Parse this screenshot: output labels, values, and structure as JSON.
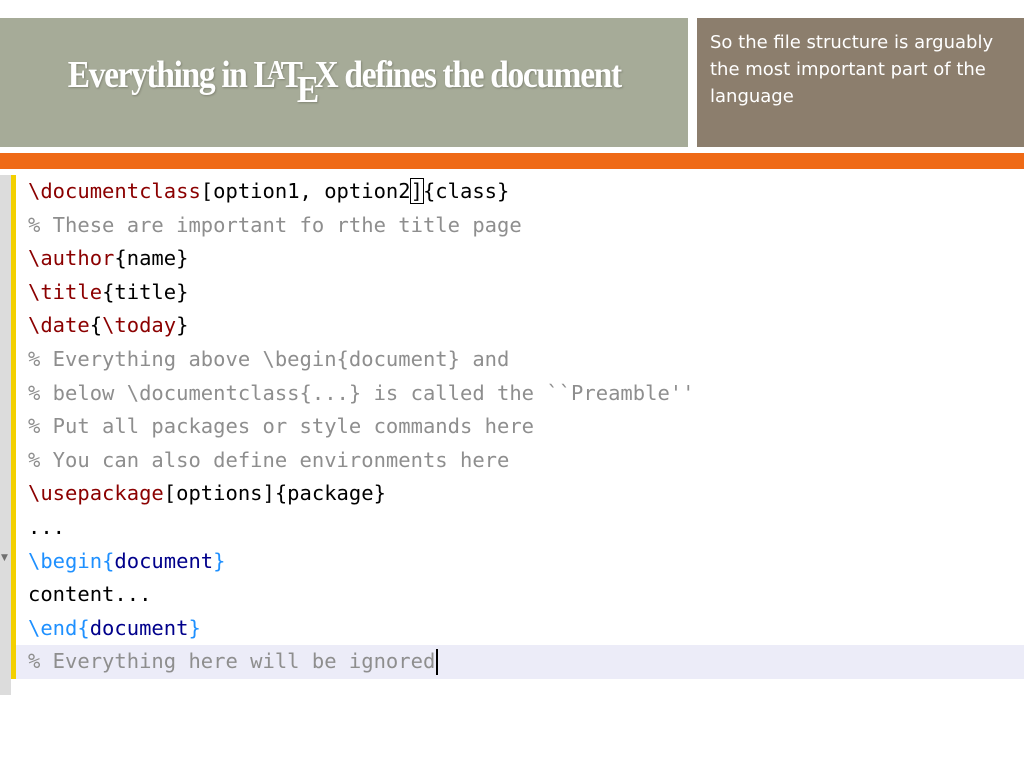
{
  "title": {
    "prefix": "Everything in ",
    "logo_l": "L",
    "logo_a": "A",
    "logo_t": "T",
    "logo_e": "E",
    "logo_x": "X",
    "suffix": " defines the document"
  },
  "note": "So the file structure is arguably the most important part of the language",
  "colors": {
    "title_band": "#a6ab98",
    "note_band": "#8c7e6d",
    "accent_bar": "#ef6a16",
    "change_bar": "#f3d000",
    "command": "#8b0000",
    "environment": "#1e90ff",
    "environment_name": "#00008b",
    "comment": "#8e8e8e"
  },
  "code": {
    "l1": {
      "cmd": "\\documentclass",
      "opts_a": "[option1, option2",
      "bracket": "]",
      "arg": "{class}"
    },
    "l2": "% These are important fo rthe title page",
    "l3": {
      "cmd": "\\author",
      "arg": "{name}"
    },
    "l4": {
      "cmd": "\\title",
      "arg": "{title}"
    },
    "l5": {
      "cmd": "\\date",
      "ob": "{",
      "inner": "\\today",
      "cb": "}"
    },
    "l6": "% Everything above \\begin{document} and",
    "l7": "% below \\documentclass{...} is called the ``Preamble''",
    "l8": "% Put all packages or style commands here",
    "l9": "% You can also define environments here",
    "l10": {
      "cmd": "\\usepackage",
      "arg": "[options]{package}"
    },
    "l11": "...",
    "l12": {
      "cmd": "\\begin",
      "ob": "{",
      "name": "document",
      "cb": "}"
    },
    "l13": "content...",
    "l14": {
      "cmd": "\\end",
      "ob": "{",
      "name": "document",
      "cb": "}"
    },
    "l15": "% Everything here will be ignored"
  }
}
